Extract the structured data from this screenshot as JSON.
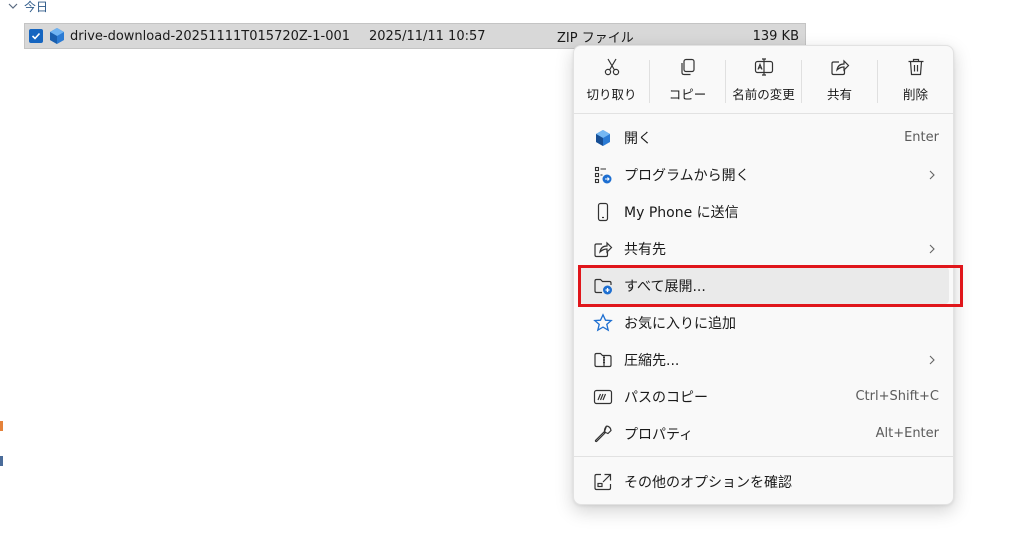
{
  "group": {
    "title": "今日"
  },
  "file": {
    "name": "drive-download-20251111T015720Z-1-001",
    "date": "2025/11/11 10:57",
    "type": "ZIP ファイル",
    "size": "139 KB"
  },
  "toolbar": {
    "cut": "切り取り",
    "copy": "コピー",
    "rename": "名前の変更",
    "share": "共有",
    "delete": "削除"
  },
  "menu": {
    "items": [
      {
        "label": "開く",
        "shortcut": "Enter"
      },
      {
        "label": "プログラムから開く",
        "shortcut": ""
      },
      {
        "label": "My Phone に送信",
        "shortcut": ""
      },
      {
        "label": "共有先",
        "shortcut": ""
      },
      {
        "label": "すべて展開...",
        "shortcut": ""
      },
      {
        "label": "お気に入りに追加",
        "shortcut": ""
      },
      {
        "label": "圧縮先...",
        "shortcut": ""
      },
      {
        "label": "パスのコピー",
        "shortcut": "Ctrl+Shift+C"
      },
      {
        "label": "プロパティ",
        "shortcut": "Alt+Enter"
      },
      {
        "label": "その他のオプションを確認",
        "shortcut": ""
      }
    ]
  },
  "colors": {
    "highlight": "#e0161b",
    "accent": "#1565c0",
    "selection": "#d8d8d8"
  },
  "icons": {
    "open": "cube-app-icon",
    "open_with": "open-with-icon",
    "phone": "phone-icon",
    "share": "share-icon",
    "extract": "folder-extract-icon",
    "favorite": "star-icon",
    "compress": "compress-folder-icon",
    "copy_path": "copy-path-icon",
    "properties": "wrench-icon",
    "more": "more-options-icon"
  }
}
